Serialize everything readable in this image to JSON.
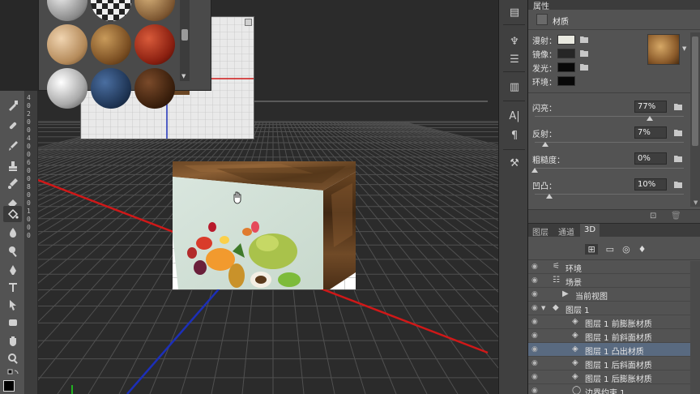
{
  "properties": {
    "panel_title": "属性",
    "section_title": "材质",
    "rows": [
      {
        "label": "漫射：",
        "color": "#e9e9e0"
      },
      {
        "label": "镜像：",
        "color": "#262626"
      },
      {
        "label": "发光：",
        "color": "#080808"
      },
      {
        "label": "环境：",
        "color": "#080808"
      }
    ],
    "sliders": [
      {
        "label": "闪亮：",
        "value": "77%",
        "fraction": 0.77
      },
      {
        "label": "反射：",
        "value": "7%",
        "fraction": 0.07
      },
      {
        "label": "粗糙度：",
        "value": "0%",
        "fraction": 0.0
      },
      {
        "label": "凹凸：",
        "value": "10%",
        "fraction": 0.1
      }
    ]
  },
  "layers_panel": {
    "tabs": [
      "图层",
      "通道",
      "3D"
    ],
    "active_tab": "3D",
    "items": [
      {
        "label": "环境",
        "icon": "environment-icon",
        "indent": 1
      },
      {
        "label": "场景",
        "icon": "scene-icon",
        "indent": 1
      },
      {
        "label": "当前视图",
        "icon": "camera-icon",
        "indent": 2
      },
      {
        "label": "图层 1",
        "icon": "mesh-icon",
        "indent": 1,
        "expanded": true
      },
      {
        "label": "图层 1 前膨胀材质",
        "icon": "material-icon",
        "indent": 3
      },
      {
        "label": "图层 1 前斜面材质",
        "icon": "material-icon",
        "indent": 3
      },
      {
        "label": "图层 1 凸出材质",
        "icon": "material-icon",
        "indent": 3,
        "selected": true
      },
      {
        "label": "图层 1 后斜面材质",
        "icon": "material-icon",
        "indent": 3
      },
      {
        "label": "图层 1 后膨胀材质",
        "icon": "material-icon",
        "indent": 3
      },
      {
        "label": "边界约束 1",
        "icon": "constraint-icon",
        "indent": 3
      }
    ]
  },
  "ruler": {
    "marks": [
      "4",
      "0",
      "2",
      "0",
      "0",
      "4",
      "0",
      "0",
      "6",
      "0",
      "0",
      "8",
      "0",
      "0",
      "1",
      "0",
      "0",
      "0"
    ]
  },
  "colors": {
    "accent_selected": "#596a80",
    "axis_red": "#d01818",
    "axis_blue": "#1c2fb8",
    "axis_green": "#22b022"
  }
}
